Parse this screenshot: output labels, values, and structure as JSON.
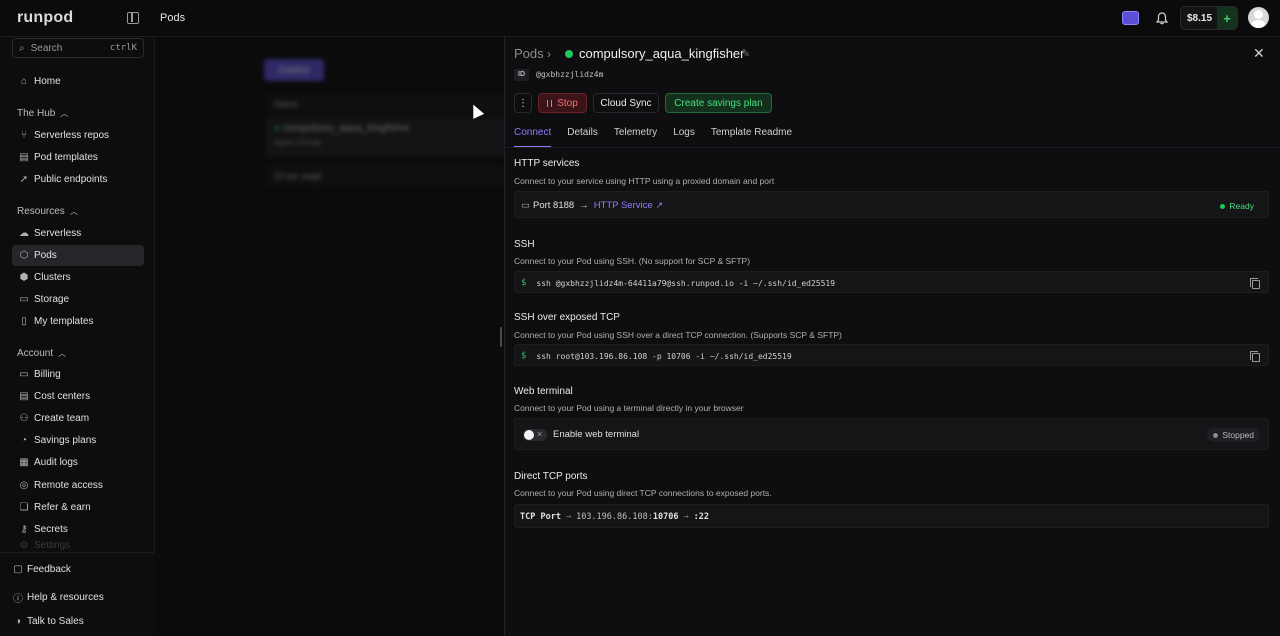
{
  "app": {
    "logo": "runpod",
    "breadcrumb": "Pods",
    "credit": "$8.15",
    "credit_add": "+"
  },
  "sidebar": {
    "search_placeholder": "Search",
    "search_shortcut": "ctrlK",
    "home": "Home",
    "hub_section": "The Hub",
    "hub_items": [
      "Serverless repos",
      "Pod templates",
      "Public endpoints"
    ],
    "resources_section": "Resources",
    "resources_items": [
      "Serverless",
      "Pods",
      "Clusters",
      "Storage",
      "My templates"
    ],
    "account_section": "Account",
    "account_items": [
      "Billing",
      "Cost centers",
      "Create team",
      "Savings plans",
      "Audit logs",
      "Remote access",
      "Refer & earn",
      "Secrets",
      "Settings"
    ],
    "footer_items": [
      "Feedback",
      "Help & resources",
      "Talk to Sales"
    ]
  },
  "list": {
    "deploy_label": "Deploy",
    "column_name": "Name",
    "row_name": "compulsory_aqua_kingfisher",
    "row_sub": "4goto-2/node",
    "per_page": "10 per page"
  },
  "pod": {
    "breadcrumb": "Pods",
    "name": "compulsory_aqua_kingfisher",
    "id_label": "ID",
    "id_value": "@gxbhzzjlidz4m",
    "status_color": "#22c55e",
    "more_label": "⋮",
    "stop_label": "Stop",
    "cloud_sync_label": "Cloud Sync",
    "savings_plan_label": "Create savings plan",
    "tabs": [
      "Connect",
      "Details",
      "Telemetry",
      "Logs",
      "Template Readme"
    ],
    "active_tab": "Connect"
  },
  "connect": {
    "http": {
      "title": "HTTP services",
      "desc": "Connect to your service using HTTP using a proxied domain and port",
      "port": "Port 8188",
      "arrow": "→",
      "service_link": "HTTP Service",
      "status": "Ready"
    },
    "ssh": {
      "title": "SSH",
      "desc": "Connect to your Pod using SSH. (No support for SCP & SFTP)",
      "command": "ssh @gxbhzzjlidz4m-64411a79@ssh.runpod.io -i ~/.ssh/id_ed25519"
    },
    "ssh_tcp": {
      "title": "SSH over exposed TCP",
      "desc": "Connect to your Pod using SSH over a direct TCP connection. (Supports SCP & SFTP)",
      "command": "ssh root@103.196.86.108 -p 10706 -i ~/.ssh/id_ed25519"
    },
    "web_terminal": {
      "title": "Web terminal",
      "desc": "Connect to your Pod using a terminal directly in your browser",
      "toggle_label": "Enable web terminal",
      "status": "Stopped"
    },
    "tcp_ports": {
      "title": "Direct TCP ports",
      "desc": "Connect to your Pod using direct TCP connections to exposed ports.",
      "label": "TCP Port",
      "ip": "103.196.86.108",
      "port": "10706",
      "internal": ":22",
      "arrow": "→"
    }
  }
}
